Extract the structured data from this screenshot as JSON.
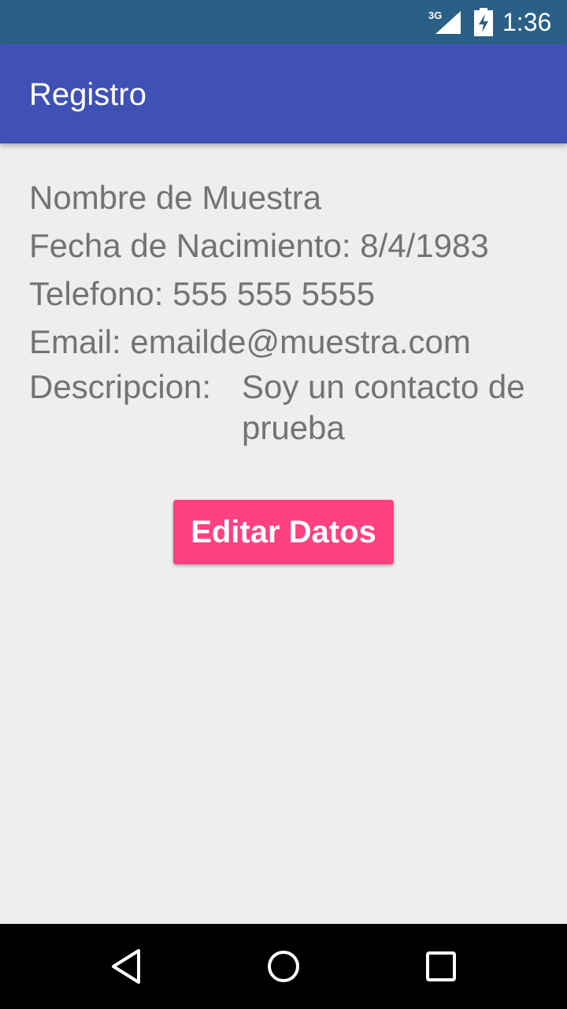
{
  "status_bar": {
    "network": "3G",
    "time": "1:36",
    "icons": [
      "signal-icon",
      "battery-charging-icon"
    ]
  },
  "app_bar": {
    "title": "Registro",
    "color": "#3f51b5"
  },
  "contact": {
    "name": "Nombre de Muestra",
    "birth_date_line": "Fecha de Nacimiento: 8/4/1983",
    "phone_line": "Telefono: 555 555 5555",
    "email_line": "Email: emailde@muestra.com",
    "description_label": "Descripcion:",
    "description_value": "Soy un contacto de prueba"
  },
  "actions": {
    "edit_label": "Editar Datos",
    "accent_color": "#ff4081"
  },
  "nav_bar": {
    "icons": [
      "back-icon",
      "home-icon",
      "recents-icon"
    ]
  }
}
